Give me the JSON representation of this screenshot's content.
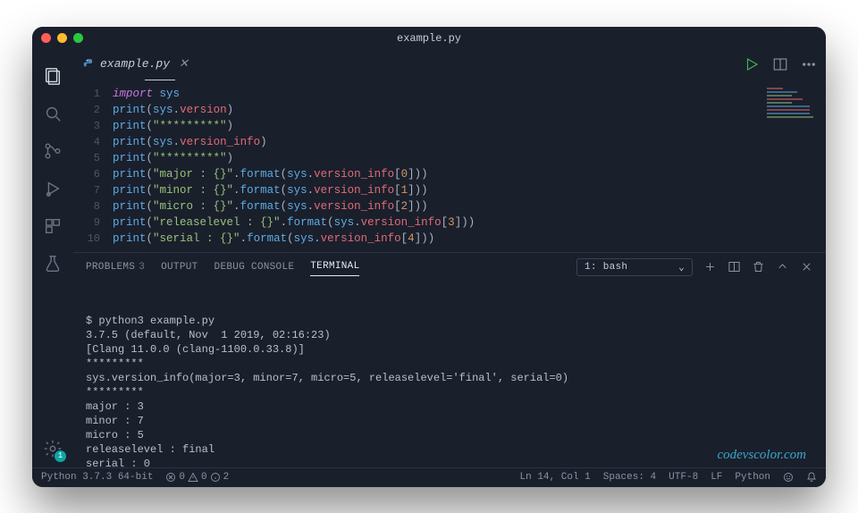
{
  "window": {
    "title": "example.py"
  },
  "tab": {
    "filename": "example.py"
  },
  "activity": {
    "settings_badge": "1"
  },
  "code_lines": [
    [
      {
        "t": "kw",
        "v": "import"
      },
      {
        "t": "sp",
        "v": " "
      },
      {
        "t": "mod",
        "v": "sys"
      }
    ],
    [
      {
        "t": "fn",
        "v": "print"
      },
      {
        "t": "punc",
        "v": "("
      },
      {
        "t": "mod",
        "v": "sys"
      },
      {
        "t": "punc",
        "v": "."
      },
      {
        "t": "prop",
        "v": "version"
      },
      {
        "t": "punc",
        "v": ")"
      }
    ],
    [
      {
        "t": "fn",
        "v": "print"
      },
      {
        "t": "punc",
        "v": "("
      },
      {
        "t": "str",
        "v": "\"*********\""
      },
      {
        "t": "punc",
        "v": ")"
      }
    ],
    [
      {
        "t": "fn",
        "v": "print"
      },
      {
        "t": "punc",
        "v": "("
      },
      {
        "t": "mod",
        "v": "sys"
      },
      {
        "t": "punc",
        "v": "."
      },
      {
        "t": "prop",
        "v": "version_info"
      },
      {
        "t": "punc",
        "v": ")"
      }
    ],
    [
      {
        "t": "fn",
        "v": "print"
      },
      {
        "t": "punc",
        "v": "("
      },
      {
        "t": "str",
        "v": "\"*********\""
      },
      {
        "t": "punc",
        "v": ")"
      }
    ],
    [
      {
        "t": "fn",
        "v": "print"
      },
      {
        "t": "punc",
        "v": "("
      },
      {
        "t": "str",
        "v": "\"major : {}\""
      },
      {
        "t": "punc",
        "v": "."
      },
      {
        "t": "fn",
        "v": "format"
      },
      {
        "t": "punc",
        "v": "("
      },
      {
        "t": "mod",
        "v": "sys"
      },
      {
        "t": "punc",
        "v": "."
      },
      {
        "t": "prop",
        "v": "version_info"
      },
      {
        "t": "punc",
        "v": "["
      },
      {
        "t": "num",
        "v": "0"
      },
      {
        "t": "punc",
        "v": "]))"
      }
    ],
    [
      {
        "t": "fn",
        "v": "print"
      },
      {
        "t": "punc",
        "v": "("
      },
      {
        "t": "str",
        "v": "\"minor : {}\""
      },
      {
        "t": "punc",
        "v": "."
      },
      {
        "t": "fn",
        "v": "format"
      },
      {
        "t": "punc",
        "v": "("
      },
      {
        "t": "mod",
        "v": "sys"
      },
      {
        "t": "punc",
        "v": "."
      },
      {
        "t": "prop",
        "v": "version_info"
      },
      {
        "t": "punc",
        "v": "["
      },
      {
        "t": "num",
        "v": "1"
      },
      {
        "t": "punc",
        "v": "]))"
      }
    ],
    [
      {
        "t": "fn",
        "v": "print"
      },
      {
        "t": "punc",
        "v": "("
      },
      {
        "t": "str",
        "v": "\"micro : {}\""
      },
      {
        "t": "punc",
        "v": "."
      },
      {
        "t": "fn",
        "v": "format"
      },
      {
        "t": "punc",
        "v": "("
      },
      {
        "t": "mod",
        "v": "sys"
      },
      {
        "t": "punc",
        "v": "."
      },
      {
        "t": "prop",
        "v": "version_info"
      },
      {
        "t": "punc",
        "v": "["
      },
      {
        "t": "num",
        "v": "2"
      },
      {
        "t": "punc",
        "v": "]))"
      }
    ],
    [
      {
        "t": "fn",
        "v": "print"
      },
      {
        "t": "punc",
        "v": "("
      },
      {
        "t": "str",
        "v": "\"releaselevel : {}\""
      },
      {
        "t": "punc",
        "v": "."
      },
      {
        "t": "fn",
        "v": "format"
      },
      {
        "t": "punc",
        "v": "("
      },
      {
        "t": "mod",
        "v": "sys"
      },
      {
        "t": "punc",
        "v": "."
      },
      {
        "t": "prop",
        "v": "version_info"
      },
      {
        "t": "punc",
        "v": "["
      },
      {
        "t": "num",
        "v": "3"
      },
      {
        "t": "punc",
        "v": "]))"
      }
    ],
    [
      {
        "t": "fn",
        "v": "print"
      },
      {
        "t": "punc",
        "v": "("
      },
      {
        "t": "str",
        "v": "\"serial : {}\""
      },
      {
        "t": "punc",
        "v": "."
      },
      {
        "t": "fn",
        "v": "format"
      },
      {
        "t": "punc",
        "v": "("
      },
      {
        "t": "mod",
        "v": "sys"
      },
      {
        "t": "punc",
        "v": "."
      },
      {
        "t": "prop",
        "v": "version_info"
      },
      {
        "t": "punc",
        "v": "["
      },
      {
        "t": "num",
        "v": "4"
      },
      {
        "t": "punc",
        "v": "]))"
      }
    ]
  ],
  "panel": {
    "tabs": {
      "problems": "PROBLEMS",
      "problems_count": "3",
      "output": "OUTPUT",
      "debug": "DEBUG CONSOLE",
      "terminal": "TERMINAL"
    },
    "terminal_select": "1: bash"
  },
  "terminal_lines": [
    "$ python3 example.py",
    "3.7.5 (default, Nov  1 2019, 02:16:23)",
    "[Clang 11.0.0 (clang-1100.0.33.8)]",
    "*********",
    "sys.version_info(major=3, minor=7, micro=5, releaselevel='final', serial=0)",
    "*********",
    "major : 3",
    "minor : 7",
    "micro : 5",
    "releaselevel : final",
    "serial : 0",
    "$ "
  ],
  "watermark": "codevscolor.com",
  "statusbar": {
    "python": "Python 3.7.3 64-bit",
    "err": "0",
    "warn": "0",
    "info": "2",
    "ln_col": "Ln 14, Col 1",
    "spaces": "Spaces: 4",
    "encoding": "UTF-8",
    "eol": "LF",
    "lang": "Python"
  }
}
